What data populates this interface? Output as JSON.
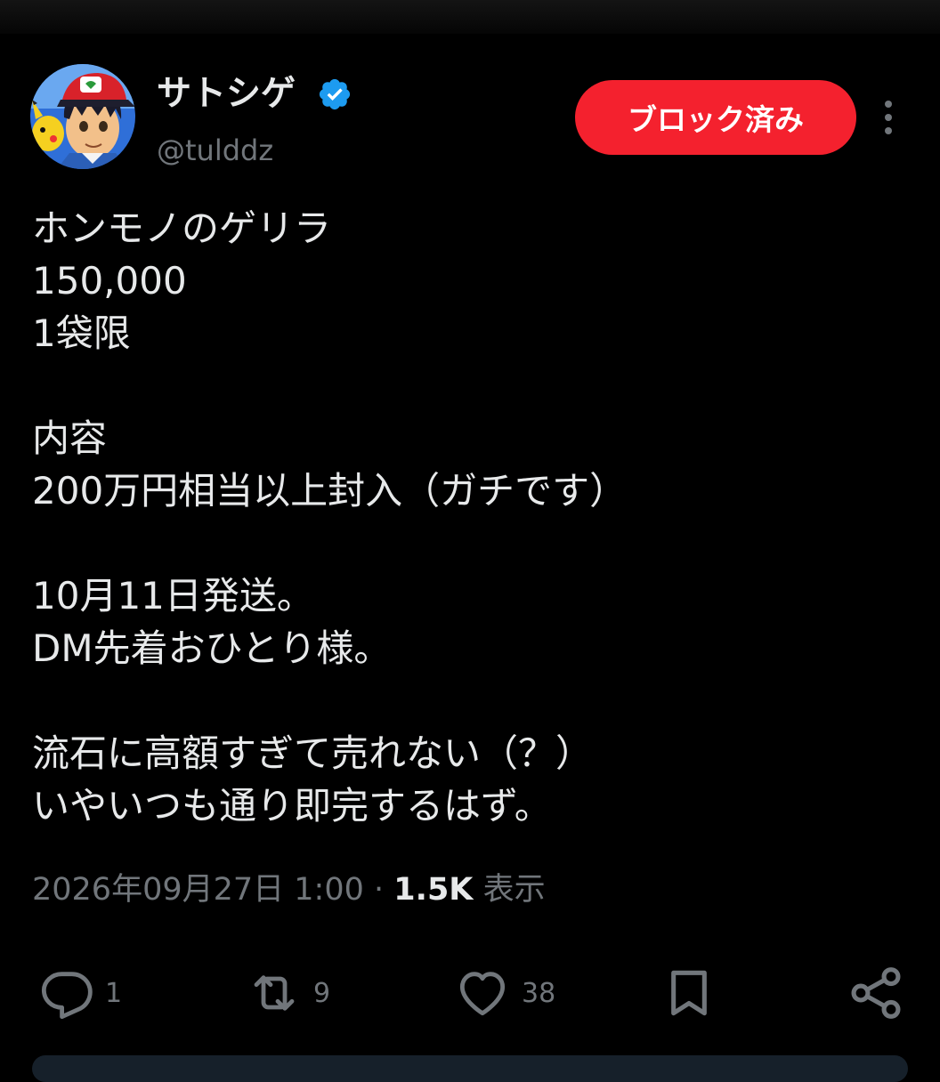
{
  "user": {
    "display_name": "サトシゲ",
    "handle": "@tulddz",
    "verified": true,
    "avatar_icon": "avatar-image"
  },
  "block_button": {
    "label": "ブロック済み",
    "color": "#f4212e"
  },
  "menu": {
    "icon": "more-vertical-icon"
  },
  "tweet": {
    "text": "ホンモノのゲリラ\n150,000\n1袋限\n\n内容\n200万円相当以上封入（ガチです）\n\n10月11日発送。\nDM先着おひとり様。\n\n流石に高額すぎて売れない（？）\nいやいつも通り即完するはず。"
  },
  "meta": {
    "datetime": "2026年09月27日 1:00",
    "separator": "·",
    "views_count": "1.5K",
    "views_label": "表示"
  },
  "actions": {
    "reply_count": "1",
    "retweet_count": "9",
    "like_count": "38"
  },
  "colors": {
    "background": "#000000",
    "text_primary": "#e7e9ea",
    "text_secondary": "#71767b",
    "verified": "#1d9bf0",
    "accent_red": "#f4212e"
  }
}
